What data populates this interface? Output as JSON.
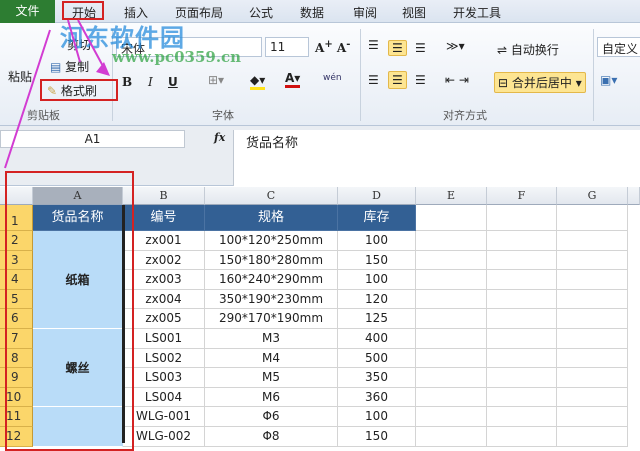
{
  "ribbon_tabs": [
    "文件",
    "开始",
    "插入",
    "页面布局",
    "公式",
    "数据",
    "审阅",
    "视图",
    "开发工具"
  ],
  "clipboard": {
    "paste": "粘贴",
    "cut": "剪切",
    "copy": "复制",
    "format_painter": "格式刷",
    "label": "剪贴板"
  },
  "font": {
    "name": "宋体",
    "size": "11",
    "bold": "B",
    "italic": "I",
    "underline": "U",
    "label": "字体",
    "phonetic": "wén"
  },
  "alignment": {
    "wrap": "自动换行",
    "merge": "合并后居中",
    "label": "对齐方式"
  },
  "number": {
    "format": "自定义"
  },
  "formula_bar": {
    "name_box": "A1",
    "fx": "fx",
    "content": "货品名称"
  },
  "watermark": {
    "name": "河东软件园",
    "url": "www.pc0359.cn"
  },
  "columns": [
    "A",
    "B",
    "C",
    "D",
    "E",
    "F",
    "G"
  ],
  "header_row": [
    "货品名称",
    "编号",
    "规格",
    "库存"
  ],
  "groups": [
    {
      "name": "纸箱"
    },
    {
      "name": "螺丝"
    }
  ],
  "rows": [
    [
      "zx001",
      "100*120*250mm",
      "100"
    ],
    [
      "zx002",
      "150*180*280mm",
      "150"
    ],
    [
      "zx003",
      "160*240*290mm",
      "100"
    ],
    [
      "zx004",
      "350*190*230mm",
      "120"
    ],
    [
      "zx005",
      "290*170*190mm",
      "125"
    ],
    [
      "LS001",
      "M3",
      "400"
    ],
    [
      "LS002",
      "M4",
      "500"
    ],
    [
      "LS003",
      "M5",
      "350"
    ],
    [
      "LS004",
      "M6",
      "360"
    ],
    [
      "WLG-001",
      "Φ6",
      "100"
    ],
    [
      "WLG-002",
      "Φ8",
      "150"
    ]
  ]
}
